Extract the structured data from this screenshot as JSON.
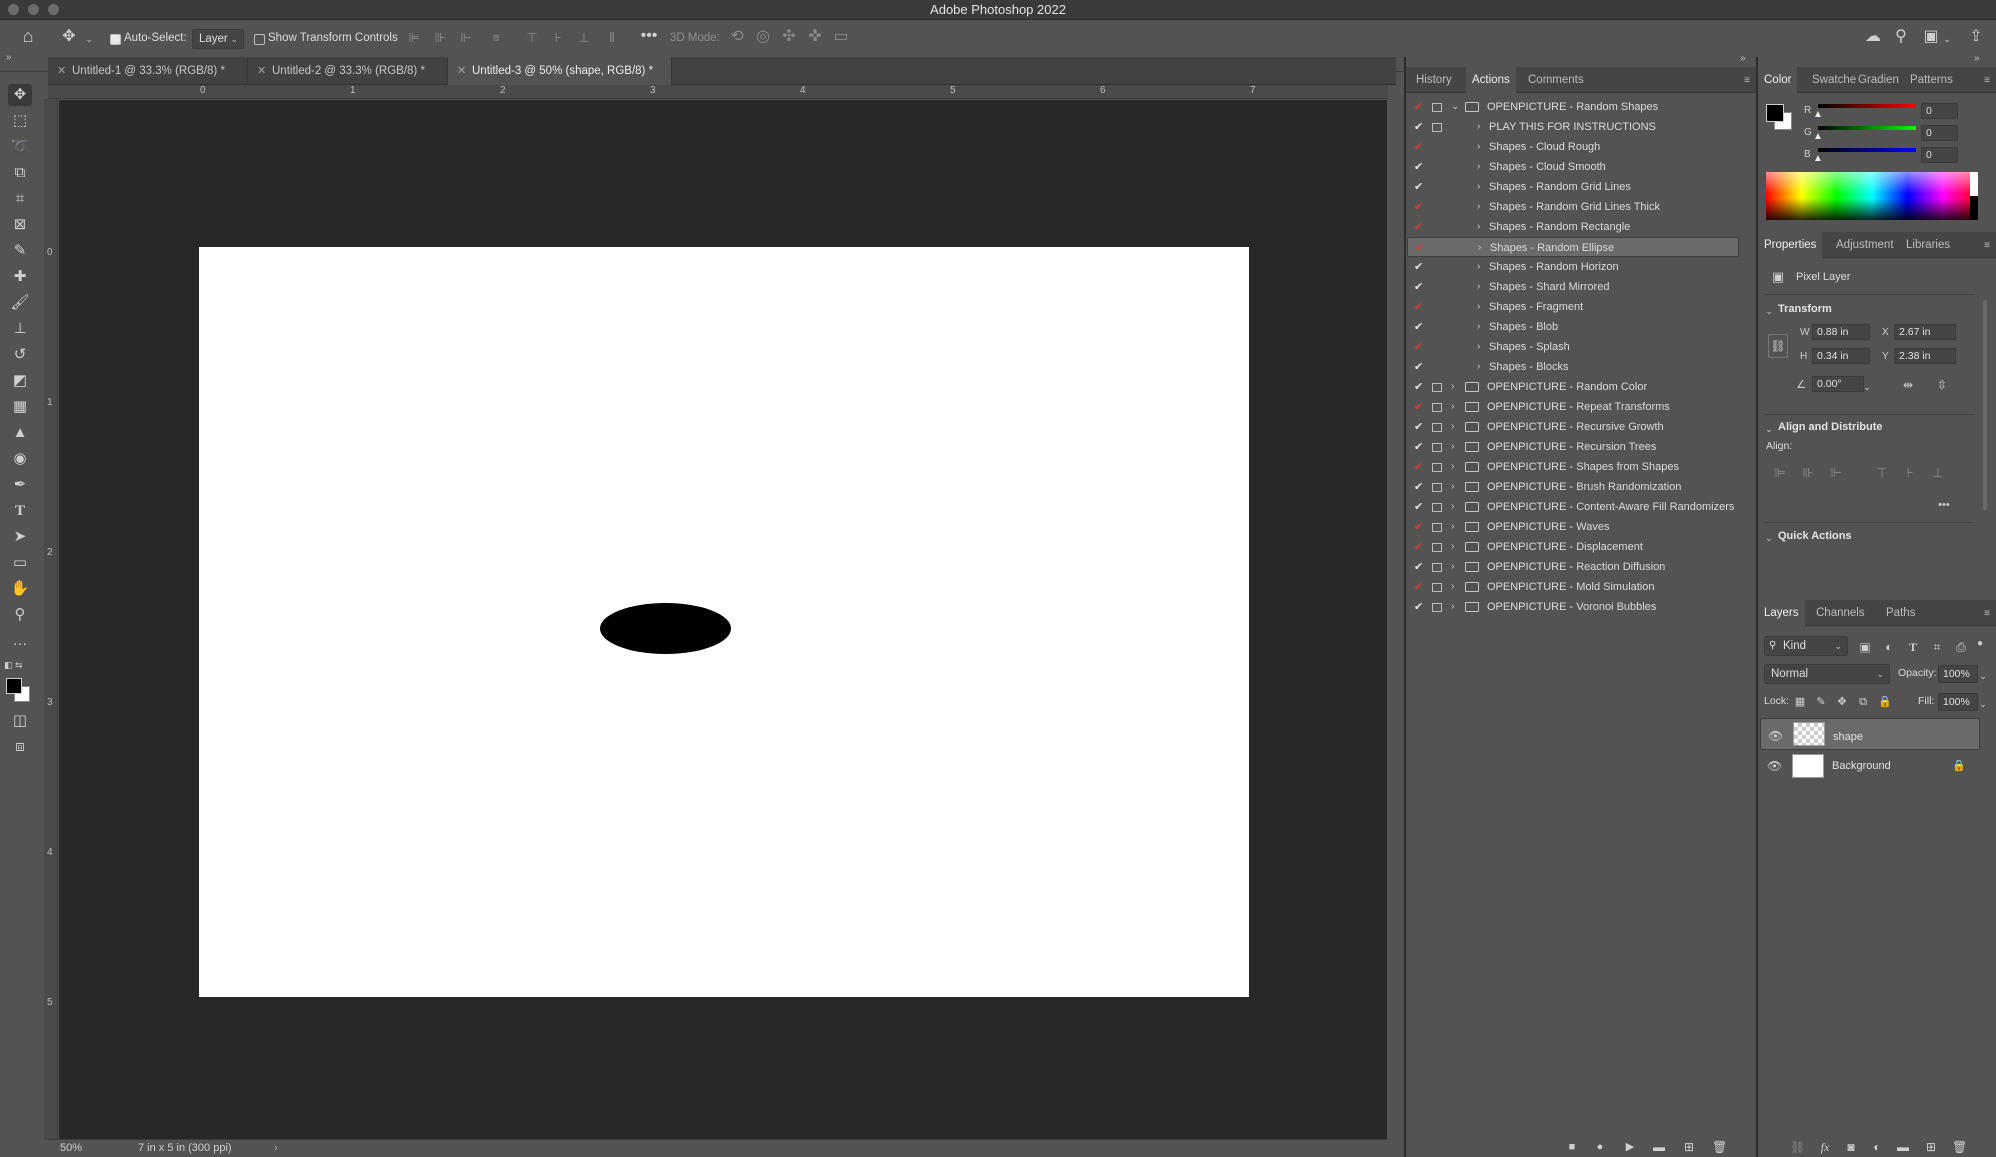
{
  "window": {
    "title": "Adobe Photoshop 2022"
  },
  "options_bar": {
    "auto_select_label": "Auto-Select:",
    "auto_select_value": "Layer",
    "show_transform_label": "Show Transform Controls",
    "mode_3d_label": "3D Mode:"
  },
  "doc_tabs": [
    {
      "label": "Untitled-1 @ 33.3% (RGB/8) *"
    },
    {
      "label": "Untitled-2 @ 33.3% (RGB/8) *"
    },
    {
      "label": "Untitled-3 @ 50% (shape, RGB/8) *"
    }
  ],
  "ruler": {
    "h": [
      "0",
      "1",
      "2",
      "3",
      "4",
      "5",
      "6",
      "7"
    ],
    "v": [
      "0",
      "1",
      "2",
      "3",
      "4",
      "5"
    ]
  },
  "status": {
    "zoom": "50%",
    "doc_info": "7 in x 5 in (300 ppi)"
  },
  "actions_panel": {
    "tabs": [
      "History",
      "Actions",
      "Comments"
    ],
    "rows": [
      {
        "label": "OPENPICTURE - Random Shapes"
      },
      {
        "label": "PLAY THIS FOR INSTRUCTIONS"
      },
      {
        "label": "Shapes - Cloud Rough"
      },
      {
        "label": "Shapes - Cloud Smooth"
      },
      {
        "label": "Shapes - Random Grid Lines"
      },
      {
        "label": "Shapes - Random Grid Lines Thick"
      },
      {
        "label": "Shapes - Random Rectangle"
      },
      {
        "label": "Shapes - Random Ellipse"
      },
      {
        "label": "Shapes - Random Horizon"
      },
      {
        "label": "Shapes - Shard Mirrored"
      },
      {
        "label": "Shapes - Fragment"
      },
      {
        "label": "Shapes - Blob"
      },
      {
        "label": "Shapes - Splash"
      },
      {
        "label": "Shapes - Blocks"
      },
      {
        "label": "OPENPICTURE - Random Color"
      },
      {
        "label": "OPENPICTURE - Repeat Transforms"
      },
      {
        "label": "OPENPICTURE - Recursive Growth"
      },
      {
        "label": "OPENPICTURE - Recursion Trees"
      },
      {
        "label": "OPENPICTURE - Shapes from Shapes"
      },
      {
        "label": "OPENPICTURE - Brush Randomization"
      },
      {
        "label": "OPENPICTURE - Content-Aware Fill Randomizers"
      },
      {
        "label": "OPENPICTURE - Waves"
      },
      {
        "label": "OPENPICTURE - Displacement"
      },
      {
        "label": "OPENPICTURE - Reaction Diffusion"
      },
      {
        "label": "OPENPICTURE - Mold Simulation"
      },
      {
        "label": "OPENPICTURE - Voronoi Bubbles"
      }
    ]
  },
  "color_panel": {
    "tabs": [
      "Color",
      "Swatche",
      "Gradien",
      "Patterns"
    ],
    "r_label": "R",
    "g_label": "G",
    "b_label": "B",
    "r": "0",
    "g": "0",
    "b": "0"
  },
  "properties_panel": {
    "tabs": [
      "Properties",
      "Adjustment",
      "Libraries"
    ],
    "layer_type": "Pixel Layer",
    "transform_title": "Transform",
    "w_label": "W",
    "h_label": "H",
    "x_label": "X",
    "y_label": "Y",
    "w": "0.88 in",
    "h": "0.34 in",
    "x": "2.67 in",
    "y": "2.38 in",
    "angle": "0.00°",
    "align_title": "Align and Distribute",
    "align_label": "Align:",
    "quick_actions_title": "Quick Actions"
  },
  "layers_panel": {
    "tabs": [
      "Layers",
      "Channels",
      "Paths"
    ],
    "kind": "Kind",
    "blend_mode": "Normal",
    "opacity_label": "Opacity:",
    "opacity": "100%",
    "lock_label": "Lock:",
    "fill_label": "Fill:",
    "fill": "100%",
    "layers": [
      {
        "name": "shape"
      },
      {
        "name": "Background"
      }
    ]
  }
}
